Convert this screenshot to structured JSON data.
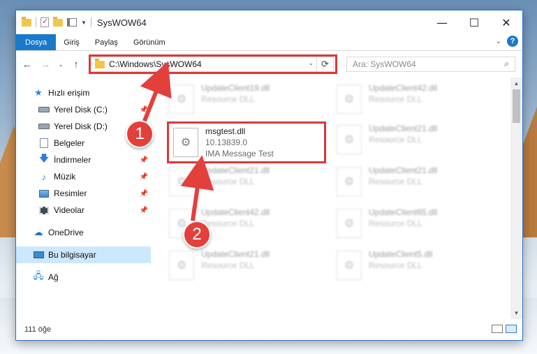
{
  "window": {
    "title": "SysWOW64",
    "controls": {
      "minimize": "—",
      "maximize": "☐",
      "close": "✕"
    }
  },
  "ribbon": {
    "tabs": [
      {
        "label": "Dosya",
        "active": true
      },
      {
        "label": "Giriş"
      },
      {
        "label": "Paylaş"
      },
      {
        "label": "Görünüm"
      }
    ],
    "help": "?"
  },
  "navigation": {
    "back": "←",
    "forward": "→",
    "recent": "⌄",
    "up": "↑",
    "address": "C:\\Windows\\SysWOW64",
    "search_placeholder": "Ara: SysWOW64"
  },
  "sidebar": {
    "quick_access": "Hızlı erişim",
    "items": [
      {
        "label": "Yerel Disk (C:)",
        "icon": "disk-icon",
        "pinned": true
      },
      {
        "label": "Yerel Disk (D:)",
        "icon": "disk-icon",
        "pinned": true
      },
      {
        "label": "Belgeler",
        "icon": "documents-icon",
        "pinned": true
      },
      {
        "label": "İndirmeler",
        "icon": "downloads-icon",
        "pinned": true
      },
      {
        "label": "Müzik",
        "icon": "music-icon",
        "pinned": true
      },
      {
        "label": "Resimler",
        "icon": "pictures-icon",
        "pinned": true
      },
      {
        "label": "Videolar",
        "icon": "videos-icon",
        "pinned": true
      }
    ],
    "onedrive": "OneDrive",
    "this_pc": "Bu bilgisayar",
    "network": "Ağ"
  },
  "files": {
    "highlighted": {
      "name": "msgtest.dll",
      "version": "10.13839.0",
      "description": "IMA Message Test"
    },
    "left_column": [
      {
        "name": "UpdateClient19.dll",
        "type": "Resource DLL"
      },
      {
        "name": "UpdateClient21.dll",
        "type": "Resource DLL"
      },
      {
        "name": "UpdateClient42.dll",
        "type": "Resource DLL"
      },
      {
        "name": "UpdateClient21.dll",
        "type": "Resource DLL"
      }
    ],
    "right_column": [
      {
        "name": "UpdateClient42.dll",
        "type": "Resource DLL"
      },
      {
        "name": "UpdateClient21.dll",
        "type": "Resource DLL"
      },
      {
        "name": "UpdateClient21.dll",
        "type": "Resource DLL"
      },
      {
        "name": "UpdateClient65.dll",
        "type": "Resource DLL"
      },
      {
        "name": "UpdateClient5.dll",
        "type": "Resource DLL"
      }
    ]
  },
  "status": {
    "item_count": "111 öğe"
  },
  "annotations": {
    "step1": "1",
    "step2": "2",
    "color": "#e3403c"
  }
}
